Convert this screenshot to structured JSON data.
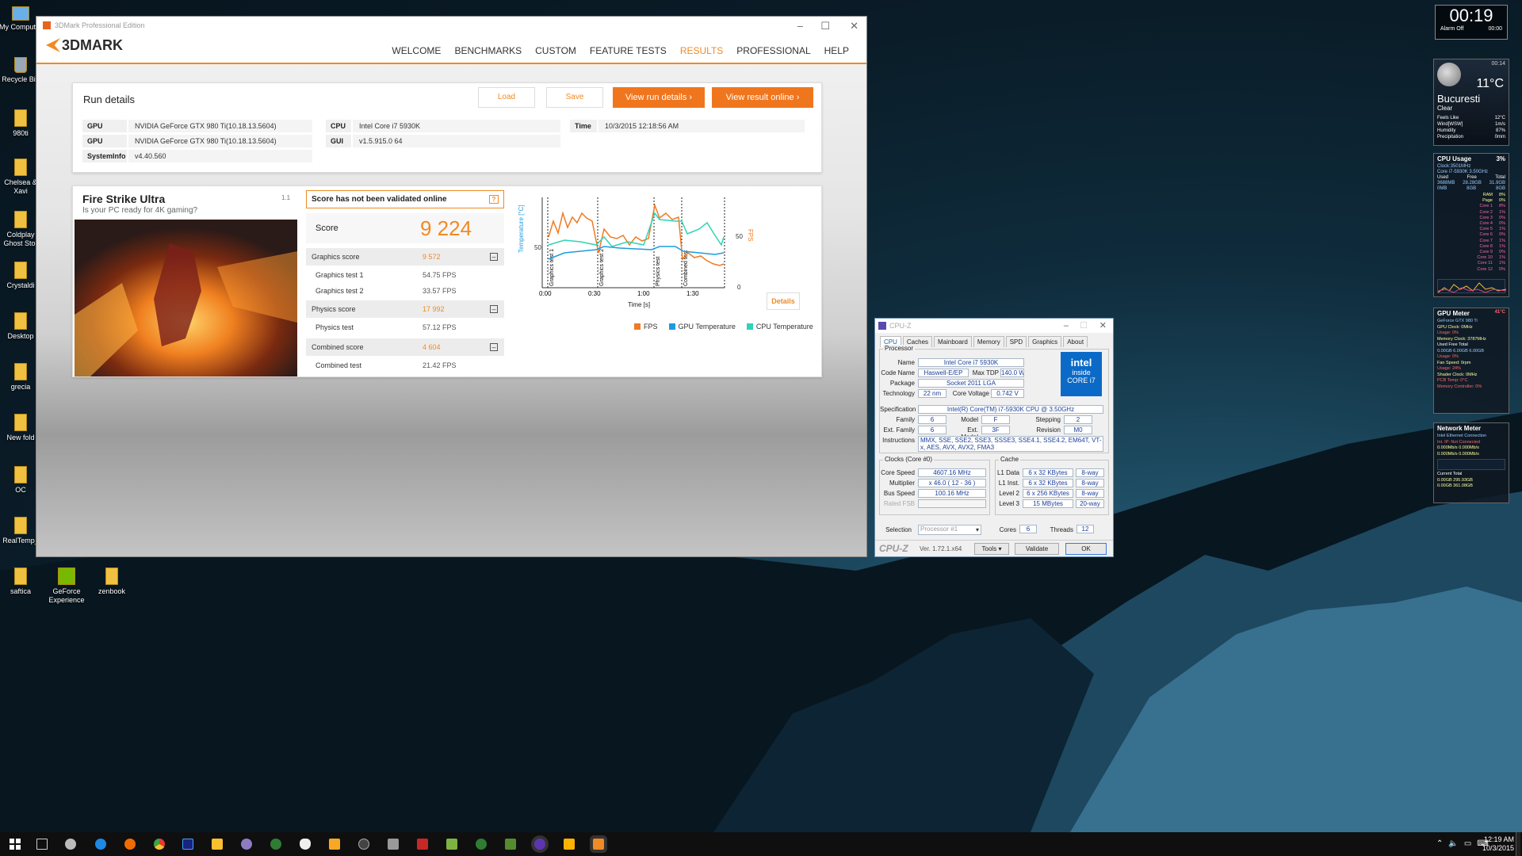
{
  "desktop_icons": [
    {
      "label": "My Computer",
      "type": "pc"
    },
    {
      "label": "Recycle Bin",
      "type": "bin"
    },
    {
      "label": "980ti",
      "type": "folder"
    },
    {
      "label": "Chelsea & Xavi",
      "type": "folder"
    },
    {
      "label": "Coldplay Ghost Stor",
      "type": "folder"
    },
    {
      "label": "Crystaldi",
      "type": "folder"
    },
    {
      "label": "Desktop",
      "type": "folder"
    },
    {
      "label": "grecia",
      "type": "folder"
    },
    {
      "label": "New fold",
      "type": "folder"
    },
    {
      "label": "OC",
      "type": "folder"
    },
    {
      "label": "RealTemp_",
      "type": "folder"
    },
    {
      "label": "saftica",
      "type": "folder"
    },
    {
      "label": "GeForce Experience",
      "type": "nv"
    },
    {
      "label": "zenbook",
      "type": "folder"
    }
  ],
  "win3d": {
    "title": "3DMark Professional Edition",
    "logo": "3DMARK",
    "nav": [
      "WELCOME",
      "BENCHMARKS",
      "CUSTOM",
      "FEATURE TESTS",
      "RESULTS",
      "PROFESSIONAL",
      "HELP"
    ],
    "nav_active": "RESULTS",
    "run": {
      "heading": "Run details",
      "load": "Load",
      "save": "Save",
      "view_run": "View run details",
      "view_online": "View result online",
      "rows": [
        {
          "k": "GPU",
          "v": "NVIDIA GeForce GTX 980 Ti(10.18.13.5604)"
        },
        {
          "k": "GPU",
          "v": "NVIDIA GeForce GTX 980 Ti(10.18.13.5604)"
        },
        {
          "k": "SystemInfo",
          "v": "v4.40.560"
        }
      ],
      "cpu_k": "CPU",
      "cpu_v": "Intel Core i7 5930K",
      "gui_k": "GUI",
      "gui_v": "v1.5.915.0 64",
      "time_k": "Time",
      "time_v": "10/3/2015 12:18:56 AM"
    },
    "result": {
      "test": "Fire Strike Ultra",
      "version": "1.1",
      "tagline": "Is your PC ready for 4K gaming?",
      "warning": "Score has not been validated online",
      "help": "?",
      "score_label": "Score",
      "score": "9 224",
      "graphics_label": "Graphics score",
      "graphics": "9 572",
      "gt1_label": "Graphics test 1",
      "gt1": "54.75 FPS",
      "gt2_label": "Graphics test 2",
      "gt2": "33.57 FPS",
      "physics_label": "Physics score",
      "physics": "17 992",
      "pt_label": "Physics test",
      "pt": "57.12 FPS",
      "combined_label": "Combined score",
      "combined": "4 604",
      "ct_label": "Combined test",
      "ct": "21.42 FPS",
      "details": "Details"
    },
    "chart": {
      "ylabel_left": "Temperature [°C]",
      "ylabel_right": "FPS",
      "xlabel": "Time [s]",
      "xticks": [
        "0:00",
        "0:30",
        "1:00",
        "1:30"
      ],
      "ytick_left": "50",
      "ytick_right_top": "50",
      "ytick_right_bottom": "0",
      "sections": [
        "Graphics test 1",
        "Graphics test 2",
        "Physics test",
        "Combined test"
      ],
      "legend": [
        {
          "name": "FPS",
          "color": "#f07a22"
        },
        {
          "name": "GPU Temperature",
          "color": "#1e9be0"
        },
        {
          "name": "CPU Temperature",
          "color": "#2fd3b8"
        }
      ]
    }
  },
  "cpuz": {
    "title": "CPU-Z",
    "tabs": [
      "CPU",
      "Caches",
      "Mainboard",
      "Memory",
      "SPD",
      "Graphics",
      "About"
    ],
    "processor_group": "Processor",
    "name_l": "Name",
    "name": "Intel Core i7 5930K",
    "code_l": "Code Name",
    "code": "Haswell-E/EP",
    "tdp_l": "Max TDP",
    "tdp": "140.0 W",
    "pkg_l": "Package",
    "pkg": "Socket 2011 LGA",
    "tech_l": "Technology",
    "tech": "22 nm",
    "cv_l": "Core Voltage",
    "cv": "0.742 V",
    "spec_l": "Specification",
    "spec": "Intel(R) Core(TM) i7-5930K CPU @ 3.50GHz",
    "fam_l": "Family",
    "fam": "6",
    "model_l": "Model",
    "model": "F",
    "step_l": "Stepping",
    "step": "2",
    "efam_l": "Ext. Family",
    "efam": "6",
    "emod_l": "Ext. Model",
    "emod": "3F",
    "rev_l": "Revision",
    "rev": "M0",
    "instr_l": "Instructions",
    "instr": "MMX, SSE, SSE2, SSE3, SSSE3, SSE4.1, SSE4.2, EM64T, VT-x, AES, AVX, AVX2, FMA3",
    "clocks_group": "Clocks (Core #0)",
    "cs_l": "Core Speed",
    "cs": "4607.16 MHz",
    "mult_l": "Multiplier",
    "mult": "x 46.0 ( 12 - 36 )",
    "bus_l": "Bus Speed",
    "bus": "100.16 MHz",
    "fsb_l": "Rated FSB",
    "cache_group": "Cache",
    "l1d_l": "L1 Data",
    "l1d": "6 x 32 KBytes",
    "l1d_w": "8-way",
    "l1i_l": "L1 Inst.",
    "l1i": "6 x 32 KBytes",
    "l1i_w": "8-way",
    "l2_l": "Level 2",
    "l2": "6 x 256 KBytes",
    "l2_w": "8-way",
    "l3_l": "Level 3",
    "l3": "15 MBytes",
    "l3_w": "20-way",
    "sel_l": "Selection",
    "sel": "Processor #1",
    "cores_l": "Cores",
    "cores": "6",
    "thr_l": "Threads",
    "thr": "12",
    "brand": "CPU-Z",
    "ver": "Ver. 1.72.1.x64",
    "tools": "Tools",
    "validate": "Validate",
    "ok": "OK",
    "intel_top": "intel",
    "intel_mid": "inside",
    "intel_bot": "CORE i7"
  },
  "gadgets": {
    "clock_time": "00:19",
    "clock_alarm": "Alarm Off",
    "clock_secs": "00:00",
    "weather_temp": "11°C",
    "weather_city": "Bucuresti",
    "weather_cond": "Clear",
    "weather_time": "00:14",
    "weather_rows": [
      {
        "k": "Feels Like",
        "v": "12°C"
      },
      {
        "k": "Wind[WSW]",
        "v": "1m/s"
      },
      {
        "k": "Humidity",
        "v": "87%"
      },
      {
        "k": "Precipitation",
        "v": "0mm"
      }
    ],
    "cpu_title": "CPU Usage",
    "cpu_pct": "3%",
    "cpu_clock": "Clock:3501MHz",
    "cpu_model": "Core i7-5930K 3.50GHz",
    "cpu_hdr": [
      "Used",
      "Free",
      "Total"
    ],
    "cpu_mem": [
      "3688MB",
      "28.28GB",
      "31.9GB"
    ],
    "cpu_ram": [
      "0MB",
      "8GB",
      "8GB"
    ],
    "cpu_rows": [
      "RAM",
      "Page",
      "Core 1",
      "Core 2",
      "Core 3",
      "Core 4",
      "Core 5",
      "Core 6",
      "Core 7",
      "Core 8",
      "Core 9",
      "Core 10",
      "Core 11",
      "Core 12"
    ],
    "cpu_vals": [
      "8%",
      "0%",
      "8%",
      "1%",
      "0%",
      "0%",
      "1%",
      "0%",
      "1%",
      "1%",
      "0%",
      "1%",
      "1%",
      "0%"
    ],
    "gpu_title": "GPU Meter",
    "gpu_name": "GeForce GTX 980 Ti",
    "gpu_lines": [
      "GPU Clock: 0MHz",
      "Usage: 0%",
      "Memory Clock: 3787MHz",
      "Used Free Total",
      "0.00GB 6.00GB 6.00GB",
      "Usage: 0%",
      "Fan Speed: 0rpm",
      "Usage: 24%",
      "Shader Clock: 0MHz",
      "PCB Temp: 0°C",
      "Memory Controller: 0%"
    ],
    "gpu_temp": "41°C",
    "net_title": "Network Meter",
    "net_lines": [
      "Intel Ethernet Connection",
      "Int. IP: Not Connected",
      "0.000Mb/s 0.000Mb/s",
      "0.000Mb/s 0.000Mb/s",
      "Current Total",
      "0.00GB 295.93GB",
      "0.00GB 361.08GB"
    ]
  },
  "taskbar": {
    "time": "12:19 AM",
    "date": "10/3/2015"
  }
}
